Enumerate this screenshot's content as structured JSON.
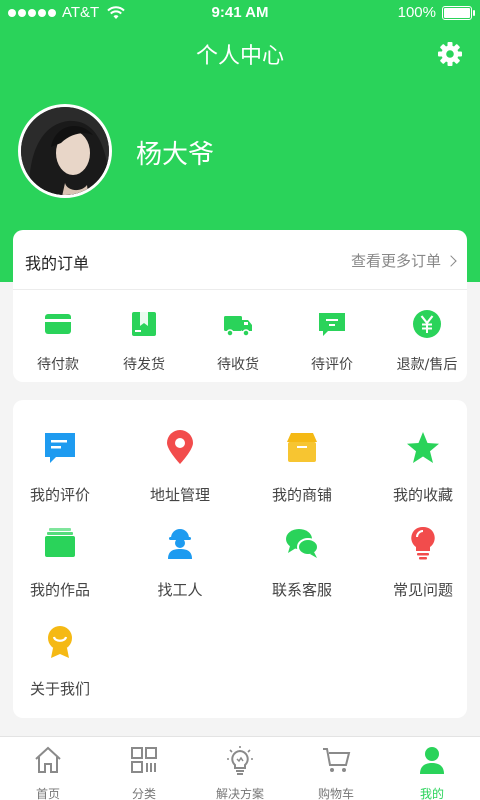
{
  "status_bar": {
    "carrier": "AT&T",
    "time": "9:41 AM",
    "battery": "100%"
  },
  "header": {
    "title": "个人中心",
    "settings_icon": "gear-icon",
    "username": "杨大爷"
  },
  "orders": {
    "title": "我的订单",
    "more": "查看更多订单",
    "items": [
      {
        "label": "待付款",
        "icon": "card-icon"
      },
      {
        "label": "待发货",
        "icon": "package-icon"
      },
      {
        "label": "待收货",
        "icon": "truck-icon"
      },
      {
        "label": "待评价",
        "icon": "comment-icon"
      },
      {
        "label": "退款/售后",
        "icon": "yen-icon"
      }
    ]
  },
  "services": {
    "items": [
      {
        "label": "我的评价",
        "icon": "review-icon"
      },
      {
        "label": "地址管理",
        "icon": "location-pin-icon"
      },
      {
        "label": "我的商铺",
        "icon": "shop-icon"
      },
      {
        "label": "我的收藏",
        "icon": "star-icon"
      },
      {
        "label": "我的作品",
        "icon": "works-icon"
      },
      {
        "label": "找工人",
        "icon": "worker-icon"
      },
      {
        "label": "联系客服",
        "icon": "chat-icon"
      },
      {
        "label": "常见问题",
        "icon": "bulb-icon"
      },
      {
        "label": "关于我们",
        "icon": "about-icon"
      }
    ]
  },
  "tabbar": {
    "items": [
      {
        "label": "首页",
        "icon": "home-icon"
      },
      {
        "label": "分类",
        "icon": "category-icon"
      },
      {
        "label": "解决方案",
        "icon": "solution-icon"
      },
      {
        "label": "购物车",
        "icon": "cart-icon"
      },
      {
        "label": "我的",
        "icon": "profile-icon",
        "active": true
      }
    ]
  },
  "colors": {
    "brand": "#2ad35a",
    "page_bg": "#f4f4f4",
    "text": "#444444"
  }
}
